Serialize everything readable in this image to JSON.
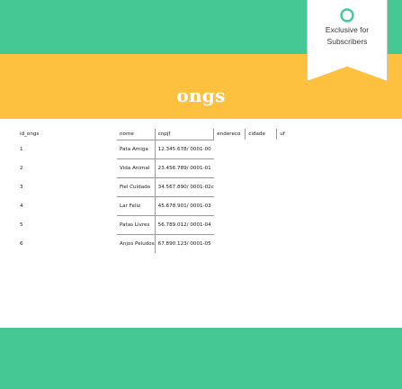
{
  "badge": {
    "icon": "circle-icon",
    "line1": "Exclusive for",
    "line2": "Subscribers"
  },
  "page_title": "ongs",
  "colors": {
    "green": "#46c895",
    "yellow": "#fec13f",
    "white": "#ffffff"
  },
  "table": {
    "headers": [
      "id_ongs",
      "nome",
      "cnpjf",
      "endereco",
      "cidade",
      "uf"
    ],
    "rows": [
      {
        "id": "1",
        "nome": "Pata Amiga",
        "cnpj": "12.345.678/ 0001-00"
      },
      {
        "id": "2",
        "nome": "Vida Animal",
        "cnpj": "23.456.789/ 0001-01"
      },
      {
        "id": "3",
        "nome": "Fiel Cuidado",
        "cnpj": "34.567.890/ 0001-02c"
      },
      {
        "id": "4",
        "nome": "Lar Feliz",
        "cnpj": "45.678.901/ 0001-03"
      },
      {
        "id": "5",
        "nome": "Patas Livres",
        "cnpj": "56.789.012/ 0001-04"
      },
      {
        "id": "6",
        "nome": "Anjos Peludos",
        "cnpj": "67.890.123/ 0001-05"
      }
    ]
  }
}
